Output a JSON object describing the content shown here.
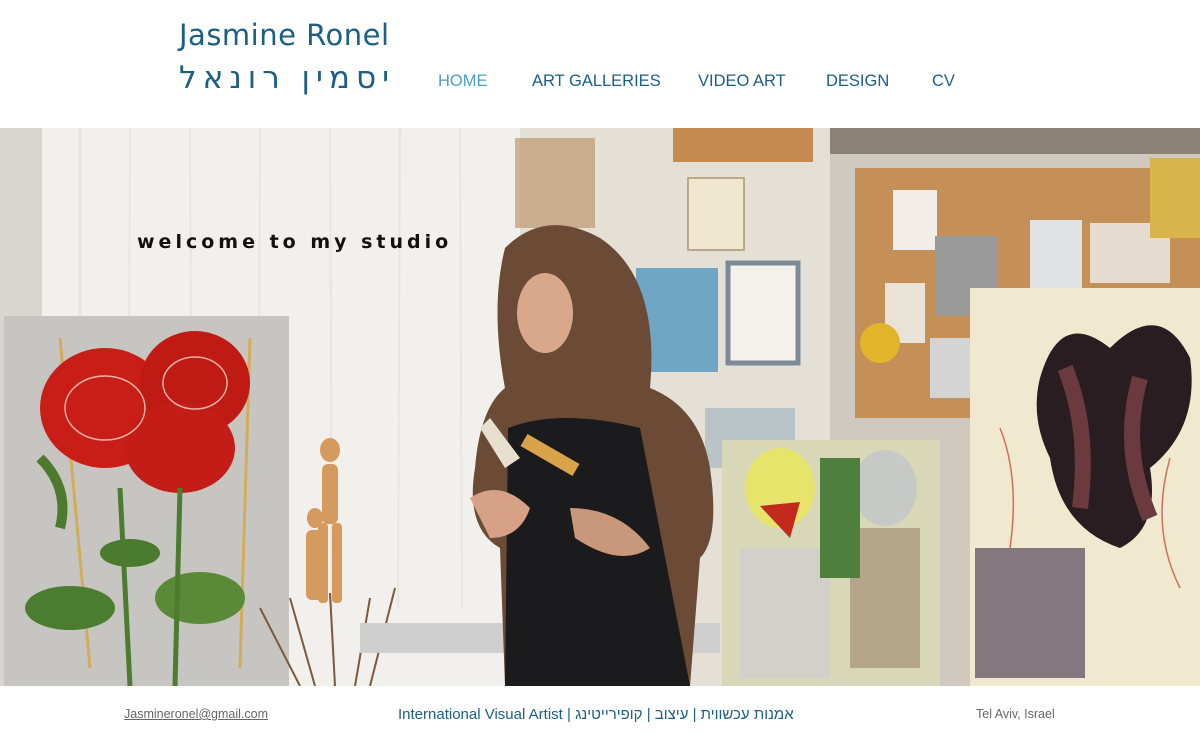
{
  "site": {
    "name_en": "Jasmine Ronel",
    "name_he": "יסמין רונאל"
  },
  "nav": {
    "items": [
      {
        "label": "HOME",
        "active": true
      },
      {
        "label": "ART GALLERIES",
        "active": false
      },
      {
        "label": "VIDEO ART",
        "active": false
      },
      {
        "label": "DESIGN",
        "active": false
      },
      {
        "label": "CV",
        "active": false
      }
    ]
  },
  "hero": {
    "heading": "welcome to my studio"
  },
  "footer": {
    "email": "Jasmineronel@gmail.com",
    "tagline": "International Visual Artist | אמנות עכשווית | עיצוב | קופירייטינג",
    "location": "Tel Aviv, Israel"
  },
  "colors": {
    "brand": "#1b5e86",
    "nav_active": "#4d9fc8",
    "footer_meta": "#666666"
  }
}
